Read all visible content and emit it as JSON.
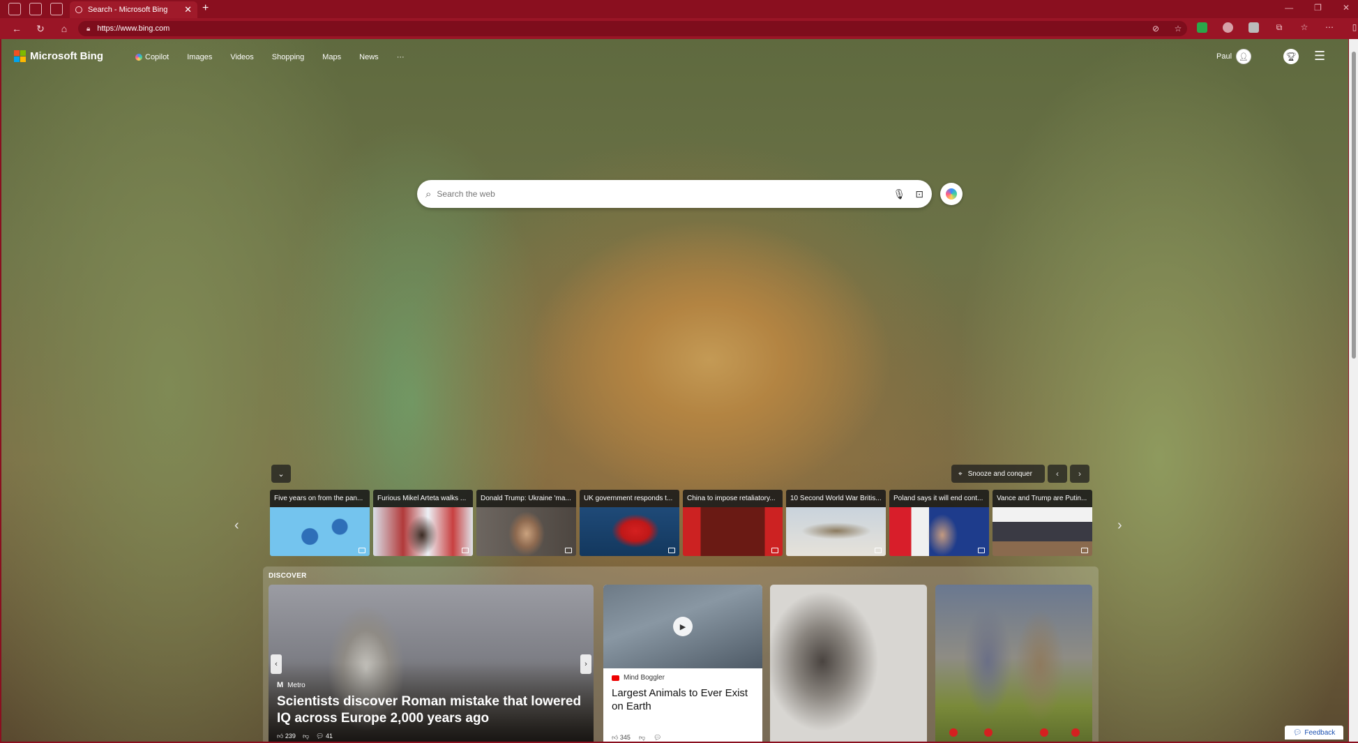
{
  "browser": {
    "tab_title": "Search - Microsoft Bing",
    "new_tab": "+",
    "url": "https://www.bing.com",
    "win_minimize": "—",
    "win_maximize": "❐",
    "win_close": "✕"
  },
  "bing": {
    "brand": "Microsoft Bing",
    "nav": [
      "Copilot",
      "Images",
      "Videos",
      "Shopping",
      "Maps",
      "News",
      "···"
    ],
    "user_name": "Paul",
    "search_placeholder": "Search the web"
  },
  "carousel": {
    "location": "Snooze and conquer",
    "news": [
      "Five years on from the pan...",
      "Furious Mikel Arteta walks ...",
      "Donald Trump: Ukraine 'ma...",
      "UK government responds t...",
      "China to impose retaliatory...",
      "10 Second World War Britis...",
      "Poland says it will end cont...",
      "Vance and Trump are Putin..."
    ]
  },
  "discover": {
    "label": "DISCOVER",
    "hero": {
      "source": "Metro",
      "title": "Scientists discover Roman mistake that lowered IQ across Europe 2,000 years ago",
      "likes": "239",
      "comments": "41"
    },
    "video": {
      "source": "Mind Boggler",
      "title": "Largest Animals to Ever Exist on Earth",
      "likes": "345"
    }
  },
  "feedback": "Feedback",
  "colors": {
    "browser_chrome": "#8a0f1f",
    "ms_red": "#f25022",
    "ms_green": "#7fba00",
    "ms_blue": "#00a4ef",
    "ms_yellow": "#ffb900"
  }
}
